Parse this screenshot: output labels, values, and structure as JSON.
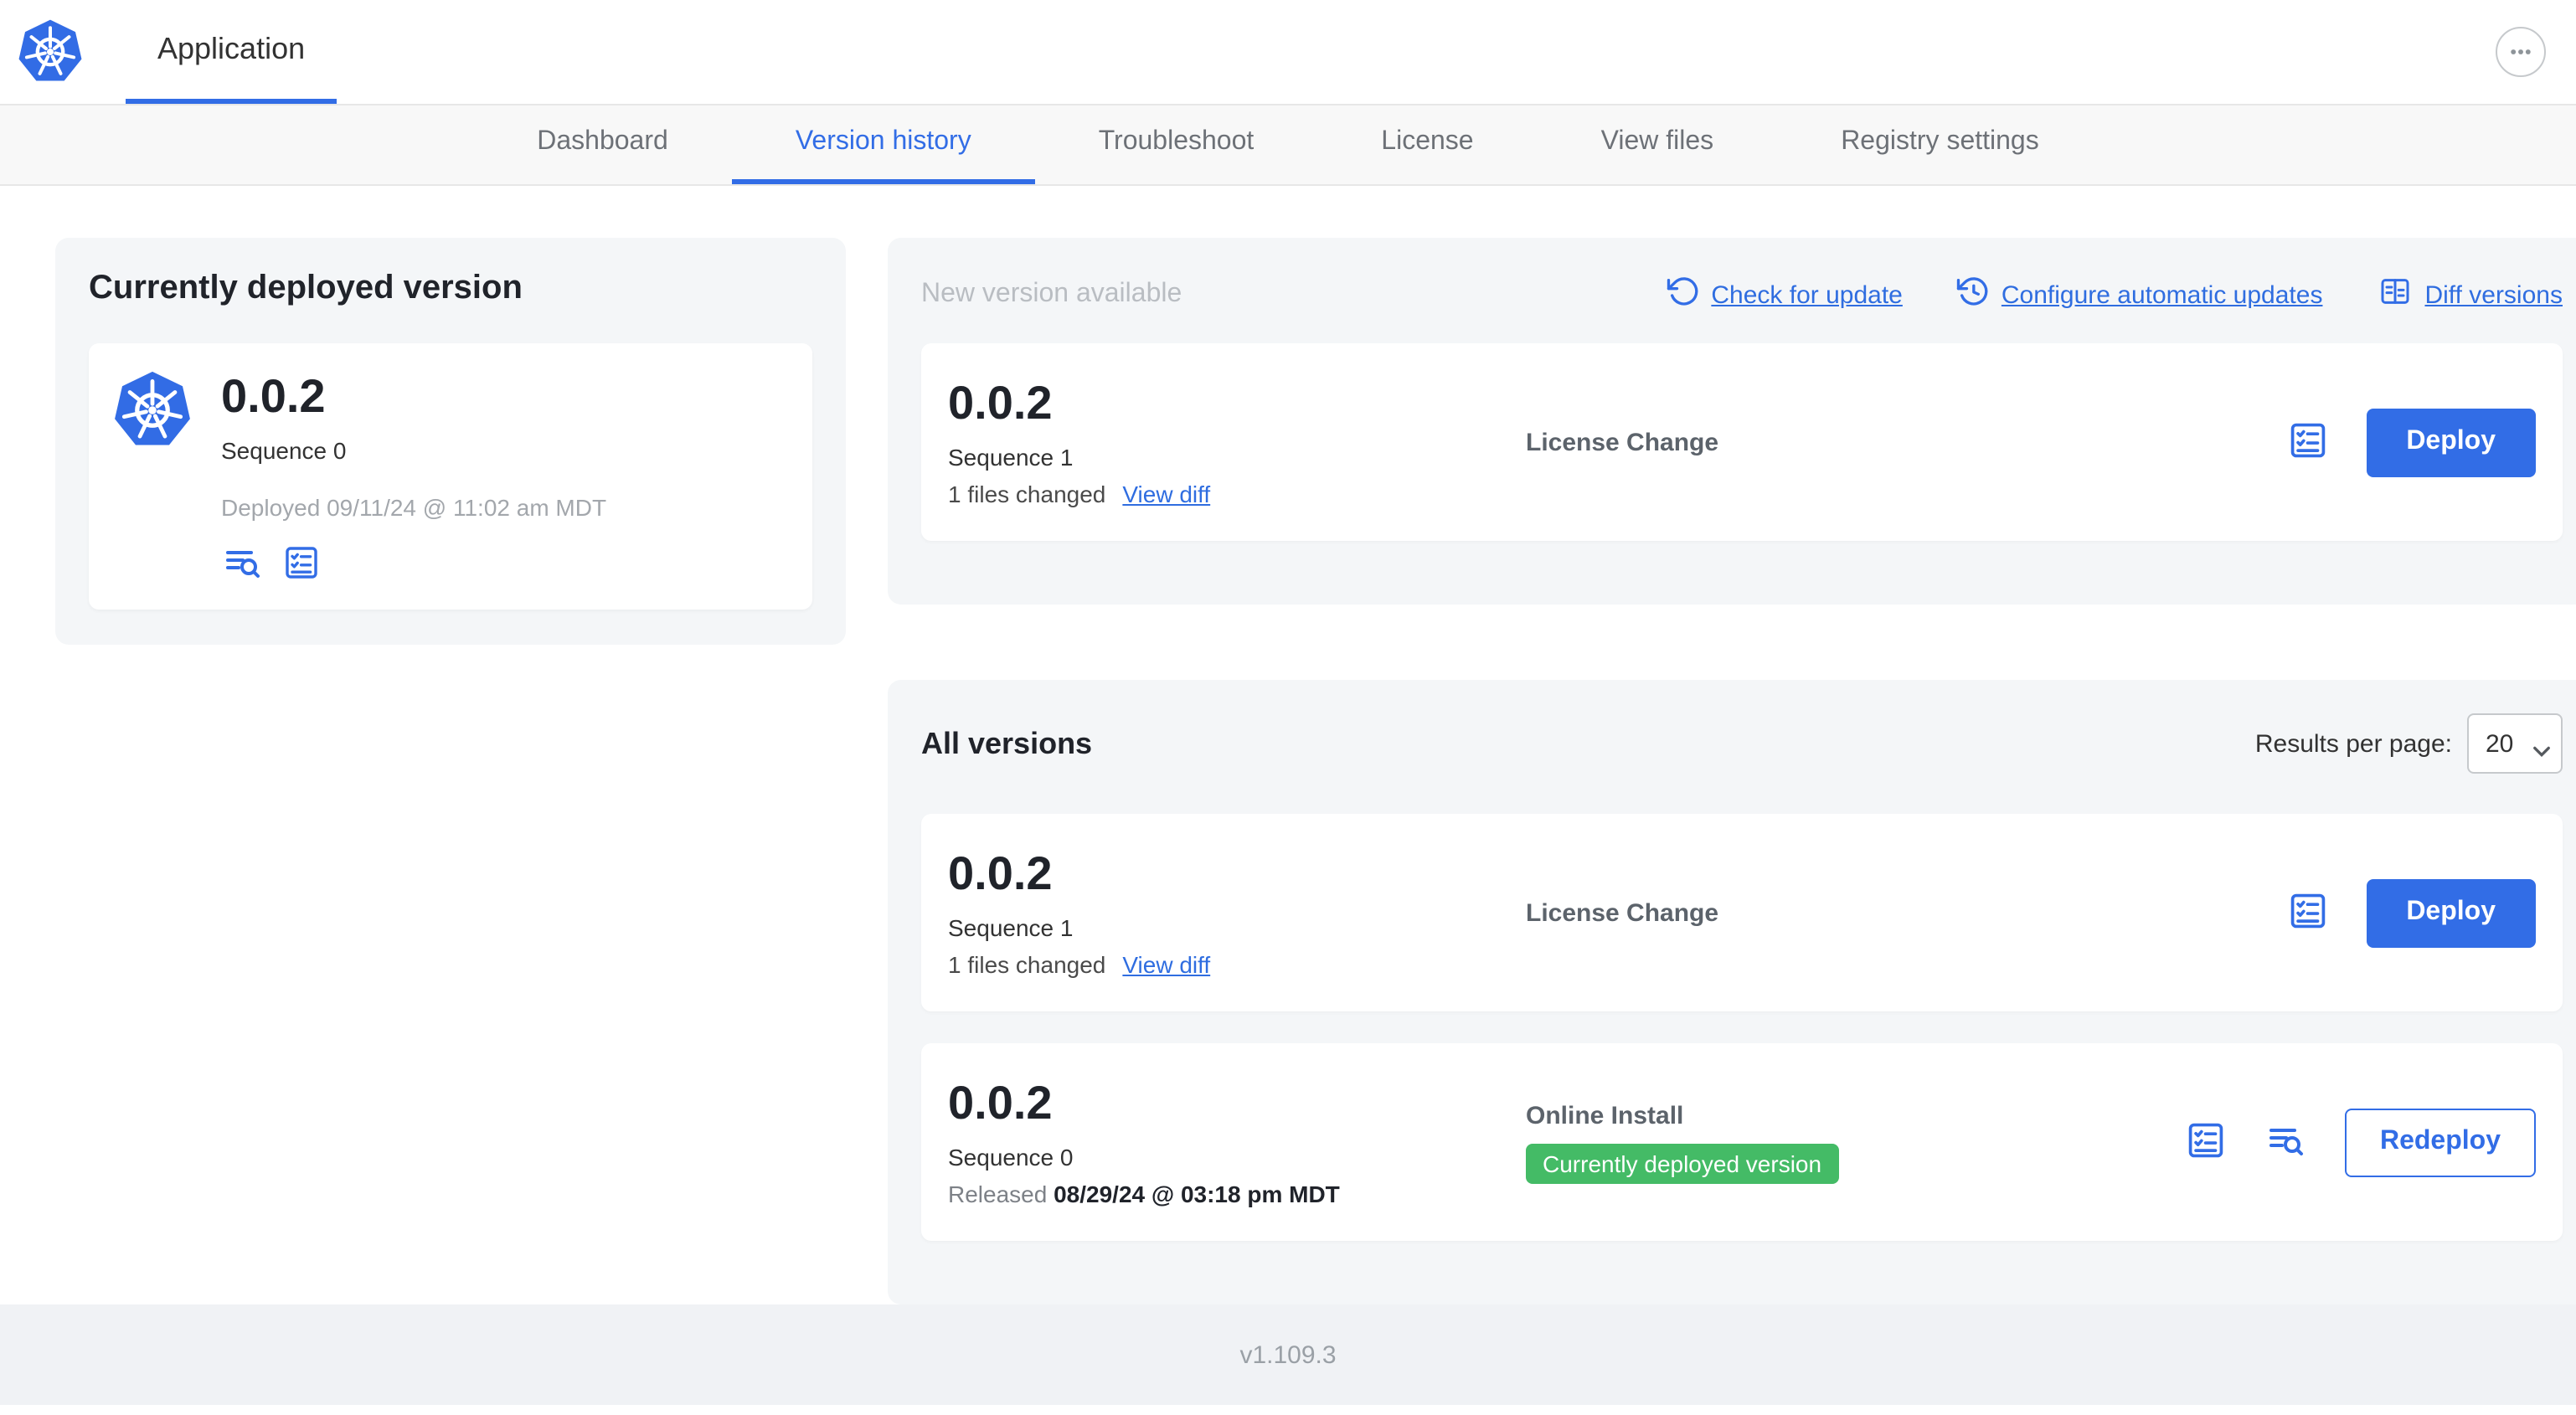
{
  "colors": {
    "accent": "#326de6",
    "link_blue": "#2f6de0",
    "badge_green": "#44bb66"
  },
  "header": {
    "title": "Application"
  },
  "nav": {
    "items": [
      {
        "label": "Dashboard",
        "active": false
      },
      {
        "label": "Version history",
        "active": true
      },
      {
        "label": "Troubleshoot",
        "active": false
      },
      {
        "label": "License",
        "active": false
      },
      {
        "label": "View files",
        "active": false
      },
      {
        "label": "Registry settings",
        "active": false
      }
    ]
  },
  "current": {
    "card_title": "Currently deployed version",
    "version": "0.0.2",
    "sequence": "Sequence 0",
    "deployed": "Deployed 09/11/24 @ 11:02 am MDT"
  },
  "new_version": {
    "title": "New version available",
    "check_for_update": "Check for update",
    "configure_updates": "Configure automatic updates",
    "diff_versions": "Diff versions",
    "row": {
      "version": "0.0.2",
      "sequence": "Sequence 1",
      "files_changed": "1 files changed",
      "view_diff": "View diff",
      "source": "License Change",
      "deploy": "Deploy"
    }
  },
  "all_versions": {
    "title": "All versions",
    "results_label": "Results per page:",
    "results_value": "20",
    "rows": [
      {
        "version": "0.0.2",
        "sequence": "Sequence 1",
        "files_changed": "1 files changed",
        "view_diff": "View diff",
        "source": "License Change",
        "action": "Deploy"
      },
      {
        "version": "0.0.2",
        "sequence": "Sequence 0",
        "released_prefix": "Released",
        "released_date": "08/29/24 @ 03:18 pm MDT",
        "source": "Online Install",
        "badge": "Currently deployed version",
        "action": "Redeploy"
      }
    ]
  },
  "footer": {
    "version": "v1.109.3"
  }
}
